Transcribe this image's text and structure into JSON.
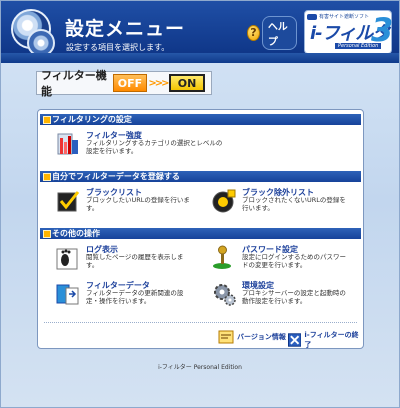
{
  "header": {
    "title": "設定メニュー",
    "subtitle": "設定する項目を選択します。",
    "help_label": "ヘルプ",
    "help_icon": "?",
    "brand": {
      "small_text": "有害サイト遮断ソフト",
      "name": "i-フィルター",
      "version": "3",
      "edition": "Personal Edition"
    }
  },
  "filter_switch": {
    "label": "フィルター機能",
    "off_label": "OFF",
    "arrows": ">>>",
    "on_label": "ON",
    "state": "ON"
  },
  "sections": {
    "filtering": {
      "title": "フィルタリングの設定",
      "items": [
        {
          "title": "フィルター強度",
          "desc": "フィルタリングするカテゴリの選択とレベルの設定を行います。"
        }
      ]
    },
    "register": {
      "title": "自分でフィルターデータを登録する",
      "items": [
        {
          "title": "ブラックリスト",
          "desc": "ブロックしたいURLの登録を行います。"
        },
        {
          "title": "ブラック除外リスト",
          "desc": "ブロックされたくないURLの登録を行います。"
        }
      ]
    },
    "other": {
      "title": "その他の操作",
      "items": [
        {
          "title": "ログ表示",
          "desc": "閲覧したページの履歴を表示します。"
        },
        {
          "title": "パスワード設定",
          "desc": "設定にログインするためのパスワードの変更を行います。"
        },
        {
          "title": "フィルターデータ",
          "desc": "フィルターデータの更新関連の設定・操作を行います。"
        },
        {
          "title": "環境設定",
          "desc": "プロキシサーバーの設定と起動時の動作設定を行います。"
        }
      ]
    }
  },
  "bottom": {
    "version_info": "バージョン情報",
    "exit": "i-フィルターの終了"
  },
  "footer": "i-フィルター Personal Edition",
  "colors": {
    "header_blue": "#0d3384",
    "section_blue": "#17439a",
    "off_orange": "#ff8a00",
    "on_yellow": "#f4c400"
  }
}
